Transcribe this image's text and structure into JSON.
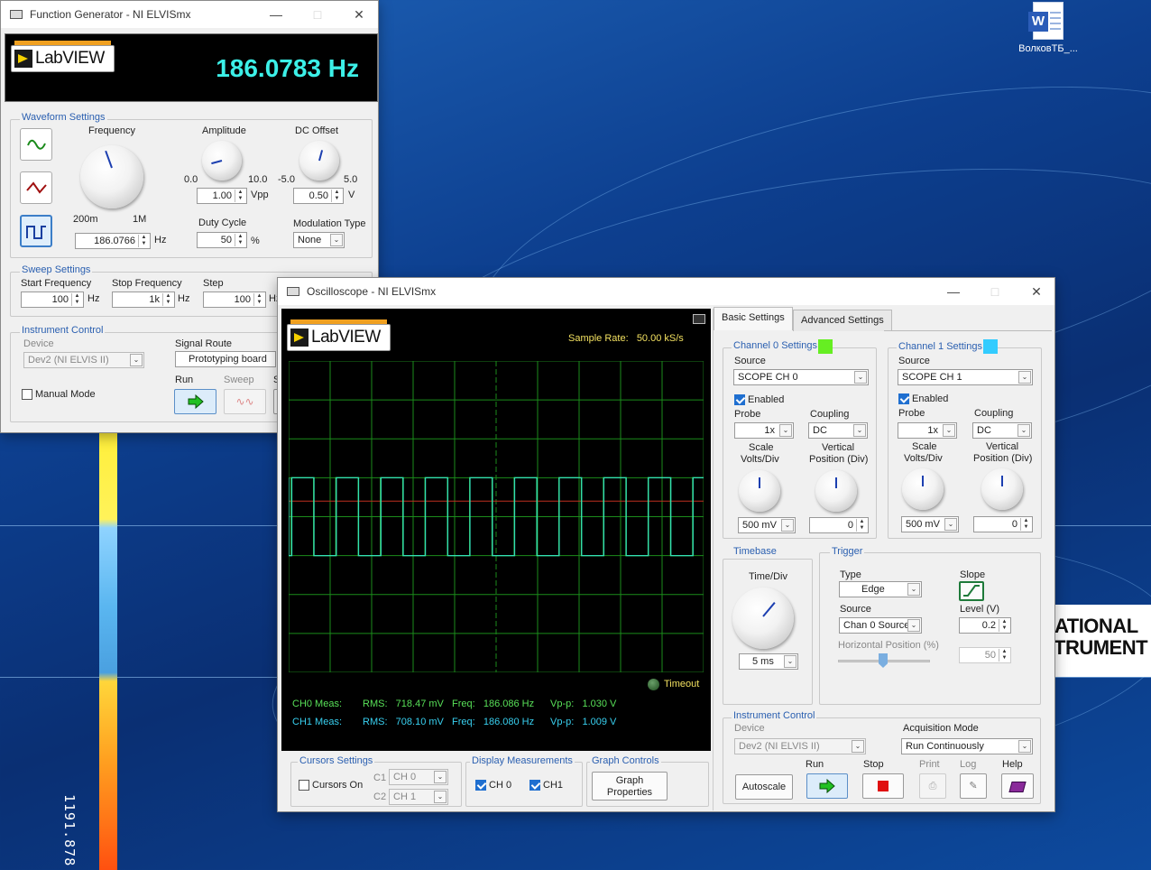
{
  "desktop": {
    "icon_label": "ВолковТБ_...",
    "strip_text": "1191.878",
    "ni_logo_lines": [
      "ATIONAL",
      "TRUMENT"
    ]
  },
  "fg": {
    "title": "Function Generator - NI ELVISmx",
    "logo_text": "LabVIEW",
    "freq_display": "186.0783 Hz",
    "waveform_title": "Waveform Settings",
    "frequency_label": "Frequency",
    "freq_min": "200m",
    "freq_max": "1M",
    "freq_value": "186.0766",
    "freq_unit": "Hz",
    "amplitude_label": "Amplitude",
    "amp_min": "0.0",
    "amp_max": "10.0",
    "amp_value": "1.00",
    "amp_unit": "Vpp",
    "dc_label": "DC Offset",
    "dc_min": "-5.0",
    "dc_max": "5.0",
    "dc_value": "0.50",
    "dc_unit": "V",
    "duty_label": "Duty Cycle",
    "duty_value": "50",
    "duty_unit": "%",
    "mod_label": "Modulation Type",
    "mod_value": "None",
    "sweep_title": "Sweep Settings",
    "start_label": "Start Frequency",
    "start_value": "100",
    "start_unit": "Hz",
    "stop_label": "Stop Frequency",
    "stop_value": "1k",
    "stop_unit": "Hz",
    "step_label": "Step",
    "step_value": "100",
    "step_unit": "Hz",
    "ic_title": "Instrument Control",
    "device_label": "Device",
    "device_value": "Dev2 (NI ELVIS II)",
    "route_label": "Signal Route",
    "route_value": "Prototyping board",
    "manual_label": "Manual Mode",
    "run_label": "Run",
    "sweep_btn_label": "Sweep",
    "s_label": "S"
  },
  "osc": {
    "title": "Oscilloscope - NI ELVISmx",
    "logo_text": "LabVIEW",
    "sample_rate": "Sample Rate:   50.00 kS/s",
    "timeout_label": "Timeout",
    "ch0": {
      "label": "CH0 Meas:",
      "rms": "RMS:   718.47 mV",
      "freq": "Freq:   186.086 Hz",
      "vpp": "Vp-p:   1.030 V"
    },
    "ch1": {
      "label": "CH1 Meas:",
      "rms": "RMS:   708.10 mV",
      "freq": "Freq:   186.080 Hz",
      "vpp": "Vp-p:   1.009 V"
    },
    "cursors_title": "Cursors Settings",
    "cursors_on": "Cursors On",
    "c1_label": "C1",
    "c1_value": "CH 0",
    "c2_label": "C2",
    "c2_value": "CH 1",
    "display_title": "Display Measurements",
    "disp_ch0": "CH 0",
    "disp_ch1": "CH1",
    "graph_title": "Graph Controls",
    "graph_props_line1": "Graph",
    "graph_props_line2": "Properties",
    "tab_basic": "Basic Settings",
    "tab_adv": "Advanced Settings",
    "ch0_settings": "Channel 0 Settings",
    "ch1_settings": "Channel 1 Settings",
    "ch0_color": "#66ee22",
    "ch1_color": "#33ccff",
    "source_label": "Source",
    "ch0_source": "SCOPE CH 0",
    "ch1_source": "SCOPE CH 1",
    "enabled_label": "Enabled",
    "probe_label": "Probe",
    "coupling_label": "Coupling",
    "probe_value": "1x",
    "coupling_value": "DC",
    "scale_label_1": "Scale",
    "scale_label_2": "Volts/Div",
    "vpos_label_1": "Vertical",
    "vpos_label_2": "Position (Div)",
    "scale_value": "500 mV",
    "vpos_value": "0",
    "timebase_title": "Timebase",
    "timediv_label": "Time/Div",
    "timediv_value": "5 ms",
    "trigger_title": "Trigger",
    "type_label": "Type",
    "type_value": "Edge",
    "slope_label": "Slope",
    "trig_source_label": "Source",
    "trig_source_value": "Chan 0 Source",
    "level_label": "Level (V)",
    "level_value": "0.2",
    "hpos_label": "Horizontal Position (%)",
    "hpos_value": "50",
    "ic_title": "Instrument Control",
    "device_label": "Device",
    "device_value": "Dev2 (NI ELVIS II)",
    "acq_label": "Acquisition Mode",
    "acq_value": "Run Continuously",
    "autoscale_label": "Autoscale",
    "run_label": "Run",
    "stop_label": "Stop",
    "print_label": "Print",
    "log_label": "Log",
    "help_label": "Help"
  },
  "waveform": {
    "type": "line",
    "series": [
      {
        "name": "CH0",
        "color": "#49e04a",
        "high": 0.5,
        "low": -0.5,
        "frequency_hz": 186.086
      },
      {
        "name": "CH1",
        "color": "#2ee0c8",
        "high": 0.5,
        "low": -0.5,
        "frequency_hz": 186.08
      }
    ],
    "trigger_level_v": 0.2,
    "grid": true
  }
}
